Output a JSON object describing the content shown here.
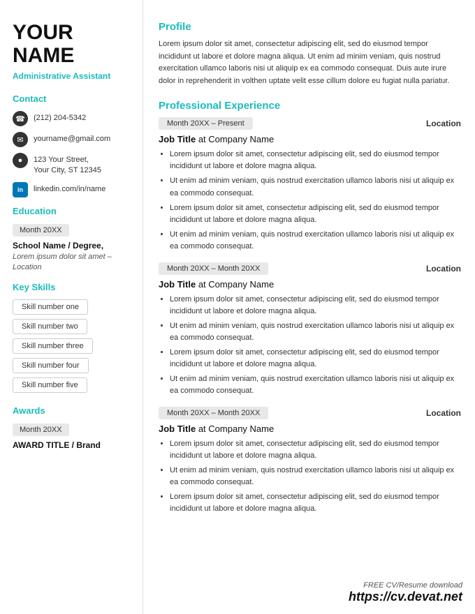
{
  "sidebar": {
    "name_first": "YOUR",
    "name_last": "NAME",
    "job_title": "Administrative Assistant",
    "contact_label": "Contact",
    "phone": "(212) 204-5342",
    "email": "yourname@gmail.com",
    "address_line1": "123 Your Street,",
    "address_line2": "Your City, ST 12345",
    "linkedin": "linkedin.com/in/name",
    "education_label": "Education",
    "edu_date": "Month 20XX",
    "edu_school": "School Name / Degree,",
    "edu_desc": "Lorem ipsum dolor sit amet – Location",
    "skills_label": "Key Skills",
    "skills": [
      "Skill number one",
      "Skill number two",
      "Skill number three",
      "Skill number four",
      "Skill number five"
    ],
    "awards_label": "Awards",
    "award_date": "Month 20XX",
    "award_title": "AWARD TITLE / Brand"
  },
  "main": {
    "profile_label": "Profile",
    "profile_text": "Lorem ipsum dolor sit amet, consectetur adipiscing elit, sed do eiusmod tempor incididunt ut labore et dolore magna aliqua. Ut enim ad minim veniam, quis nostrud exercitation ullamco laboris nisi ut aliquip ex ea commodo consequat. Duis aute irure dolor in reprehenderit in volthen uptate velit esse cillum dolore eu fugiat nulla pariatur.",
    "exp_label": "Professional Experience",
    "experiences": [
      {
        "date": "Month 20XX – Present",
        "location": "Location",
        "job_title": "Job Title",
        "company": "Company Name",
        "bullets": [
          "Lorem ipsum dolor sit amet, consectetur adipiscing elit, sed do eiusmod tempor incididunt ut labore et dolore magna aliqua.",
          "Ut enim ad minim veniam, quis nostrud exercitation ullamco laboris nisi ut aliquip ex ea commodo consequat.",
          "Lorem ipsum dolor sit amet, consectetur adipiscing elit, sed do eiusmod tempor incididunt ut labore et dolore magna aliqua.",
          "Ut enim ad minim veniam, quis nostrud exercitation ullamco laboris nisi ut aliquip ex ea commodo consequat."
        ]
      },
      {
        "date": "Month 20XX – Month 20XX",
        "location": "Location",
        "job_title": "Job Title",
        "company": "Company Name",
        "bullets": [
          "Lorem ipsum dolor sit amet, consectetur adipiscing elit, sed do eiusmod tempor incididunt ut labore et dolore magna aliqua.",
          "Ut enim ad minim veniam, quis nostrud exercitation ullamco laboris nisi ut aliquip ex ea commodo consequat.",
          "Lorem ipsum dolor sit amet, consectetur adipiscing elit, sed do eiusmod tempor incididunt ut labore et dolore magna aliqua.",
          "Ut enim ad minim veniam, quis nostrud exercitation ullamco laboris nisi ut aliquip ex ea commodo consequat."
        ]
      },
      {
        "date": "Month 20XX – Month 20XX",
        "location": "Location",
        "job_title": "Job Title",
        "company": "Company Name",
        "bullets": [
          "Lorem ipsum dolor sit amet, consectetur adipiscing elit, sed do eiusmod tempor incididunt ut labore et dolore magna aliqua.",
          "Ut enim ad minim veniam, quis nostrud exercitation ullamco laboris nisi ut aliquip ex ea commodo consequat.",
          "Lorem ipsum dolor sit amet, consectetur adipiscing elit, sed do eiusmod tempor incididunt ut labore et dolore magna aliqua."
        ]
      }
    ]
  },
  "watermark": {
    "small": "FREE CV/Resume download",
    "url": "https://cv.devat.net"
  }
}
